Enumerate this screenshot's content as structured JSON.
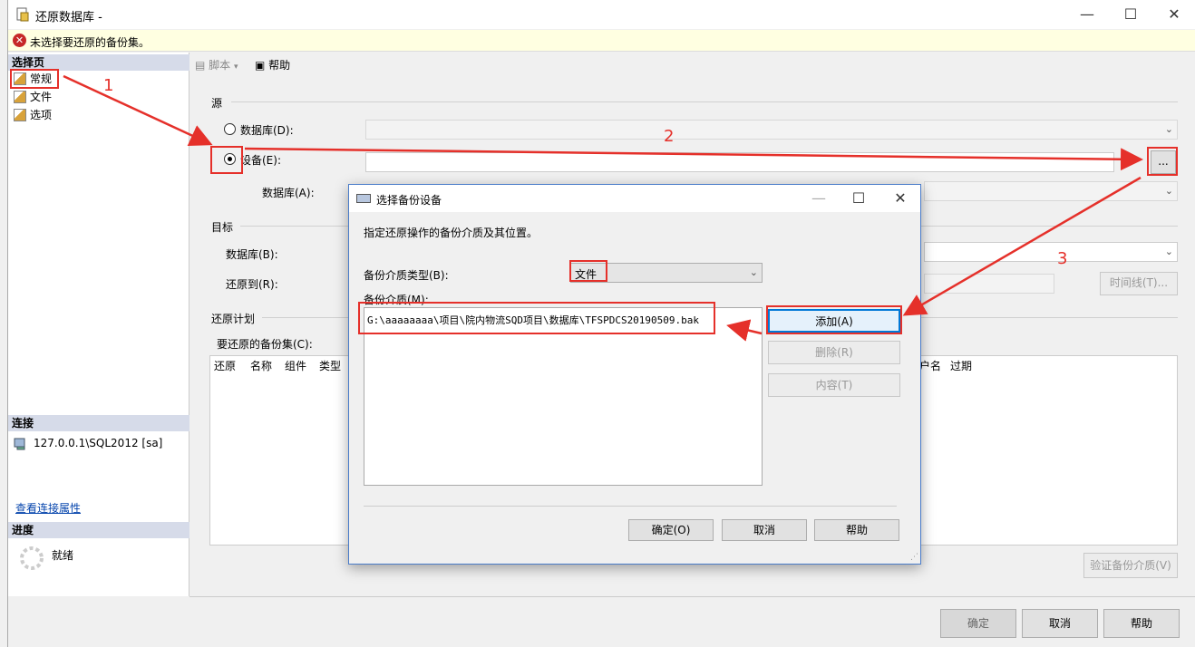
{
  "window": {
    "title": "还原数据库 -",
    "min": "—",
    "max": "☐",
    "close": "✕"
  },
  "error": {
    "icon": "error-icon",
    "text": "未选择要还原的备份集。"
  },
  "left": {
    "select_page_header": "选择页",
    "pages": [
      "常规",
      "文件",
      "选项"
    ],
    "connection_header": "连接",
    "connection": "127.0.0.1\\SQL2012 [sa]",
    "view_connection": "查看连接属性",
    "progress_header": "进度",
    "progress_status": "就绪"
  },
  "toolbar": {
    "script": "脚本",
    "help": "帮助"
  },
  "source": {
    "label": "源",
    "database_radio": "数据库(D):",
    "device_radio": "设备(E):",
    "database_label": "数据库(A):",
    "browse": "..."
  },
  "target": {
    "label": "目标",
    "database_label": "数据库(B):",
    "restore_to_label": "还原到(R):",
    "timeline": "时间线(T)..."
  },
  "plan": {
    "label": "还原计划",
    "sets_label": "要还原的备份集(C):",
    "columns": [
      "还原",
      "名称",
      "组件",
      "类型"
    ],
    "columns_right": [
      "户名",
      "过期"
    ],
    "verify": "验证备份介质(V)"
  },
  "footer": {
    "ok": "确定",
    "cancel": "取消",
    "help": "帮助"
  },
  "dialog": {
    "title": "选择备份设备",
    "desc": "指定还原操作的备份介质及其位置。",
    "type_label": "备份介质类型(B):",
    "type_value": "文件",
    "media_label": "备份介质(M):",
    "media_items": [
      "G:\\aaaaaaaa\\项目\\院内物流SQD项目\\数据库\\TFSPDCS20190509.bak"
    ],
    "add": "添加(A)",
    "remove": "删除(R)",
    "contents": "内容(T)",
    "ok": "确定(O)",
    "cancel": "取消",
    "help": "帮助"
  },
  "annotations": {
    "n1": "1",
    "n2": "2",
    "n3": "3",
    "color": "#e5302a"
  }
}
